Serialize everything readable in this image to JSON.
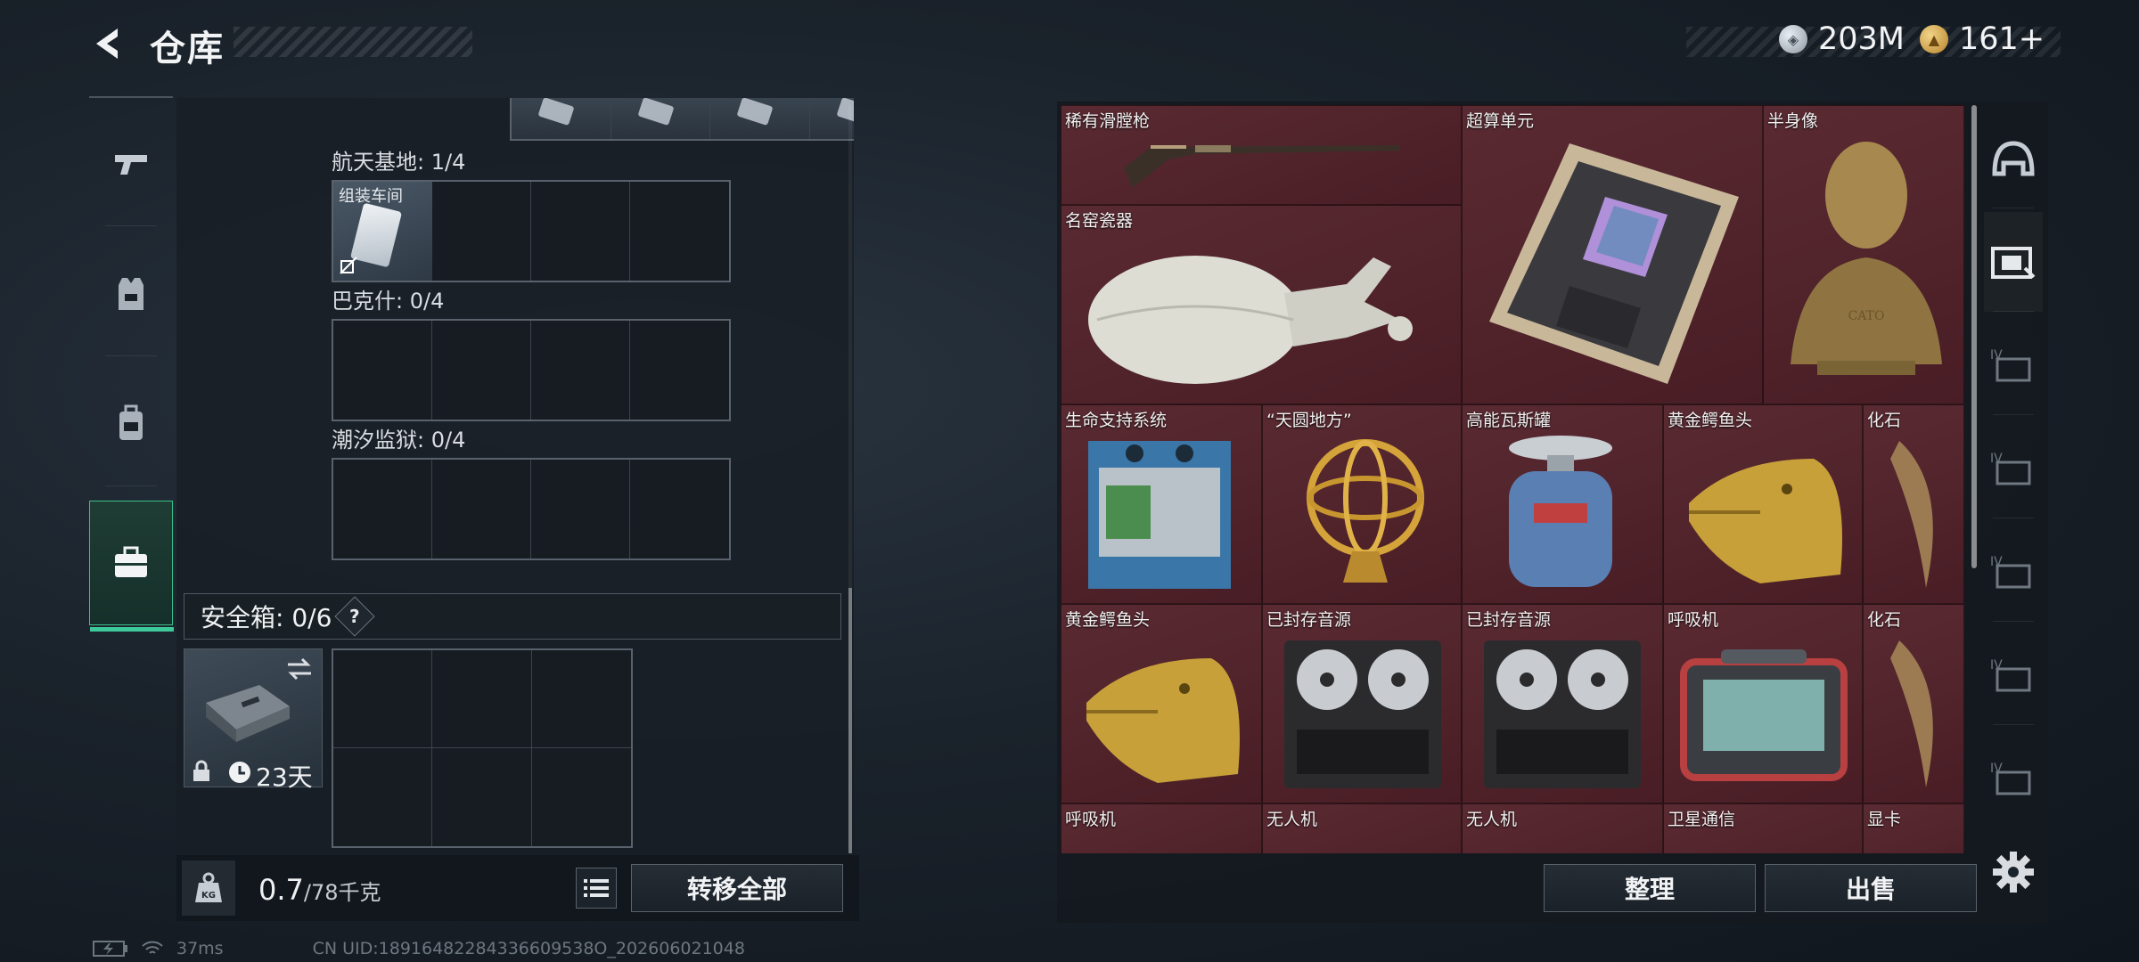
{
  "header": {
    "title": "仓库"
  },
  "currency": {
    "silver": "203M",
    "gold": "161+"
  },
  "left_nav": [
    {
      "icon": "gun-icon",
      "active": false
    },
    {
      "icon": "armor-vest-icon",
      "active": false
    },
    {
      "icon": "backpack-icon",
      "active": false
    },
    {
      "icon": "toolbox-icon",
      "active": true
    }
  ],
  "keycard_sections": [
    {
      "label": "航天基地: 1/4",
      "card": "组装车间"
    },
    {
      "label": "巴克什: 0/4"
    },
    {
      "label": "潮汐监狱: 0/4"
    }
  ],
  "safe": {
    "label": "安全箱:  0/6",
    "help": "?",
    "timer": "23天"
  },
  "bottom": {
    "weight_value": "0.7",
    "weight_max": "/78千克",
    "transfer_all": "转移全部"
  },
  "status": {
    "ping": "37ms",
    "uid": "CN UID:18916482284336609538O_202606021048"
  },
  "items": [
    {
      "name": "稀有滑膛枪"
    },
    {
      "name": "超算单元"
    },
    {
      "name": "半身像"
    },
    {
      "name": "名窑瓷器"
    },
    {
      "name": "生命支持系统"
    },
    {
      "name": "“天圆地方”"
    },
    {
      "name": "高能瓦斯罐"
    },
    {
      "name": "黄金鳄鱼头"
    },
    {
      "name": "化石"
    },
    {
      "name": "黄金鳄鱼头"
    },
    {
      "name": "已封存音源"
    },
    {
      "name": "已封存音源"
    },
    {
      "name": "呼吸机"
    },
    {
      "name": "化石"
    },
    {
      "name": "呼吸机"
    },
    {
      "name": "无人机"
    },
    {
      "name": "无人机"
    },
    {
      "name": "卫星通信"
    },
    {
      "name": "显卡"
    }
  ],
  "actions": {
    "sort": "整理",
    "sell": "出售"
  },
  "right_nav": [
    {
      "icon": "helmet-icon"
    },
    {
      "icon": "stash-tab-active-icon"
    },
    {
      "icon": "stash-tab-iv-icon"
    },
    {
      "icon": "stash-tab-iv-icon"
    },
    {
      "icon": "stash-tab-iv-icon"
    },
    {
      "icon": "stash-tab-iv-icon"
    },
    {
      "icon": "stash-tab-iv-icon"
    }
  ]
}
